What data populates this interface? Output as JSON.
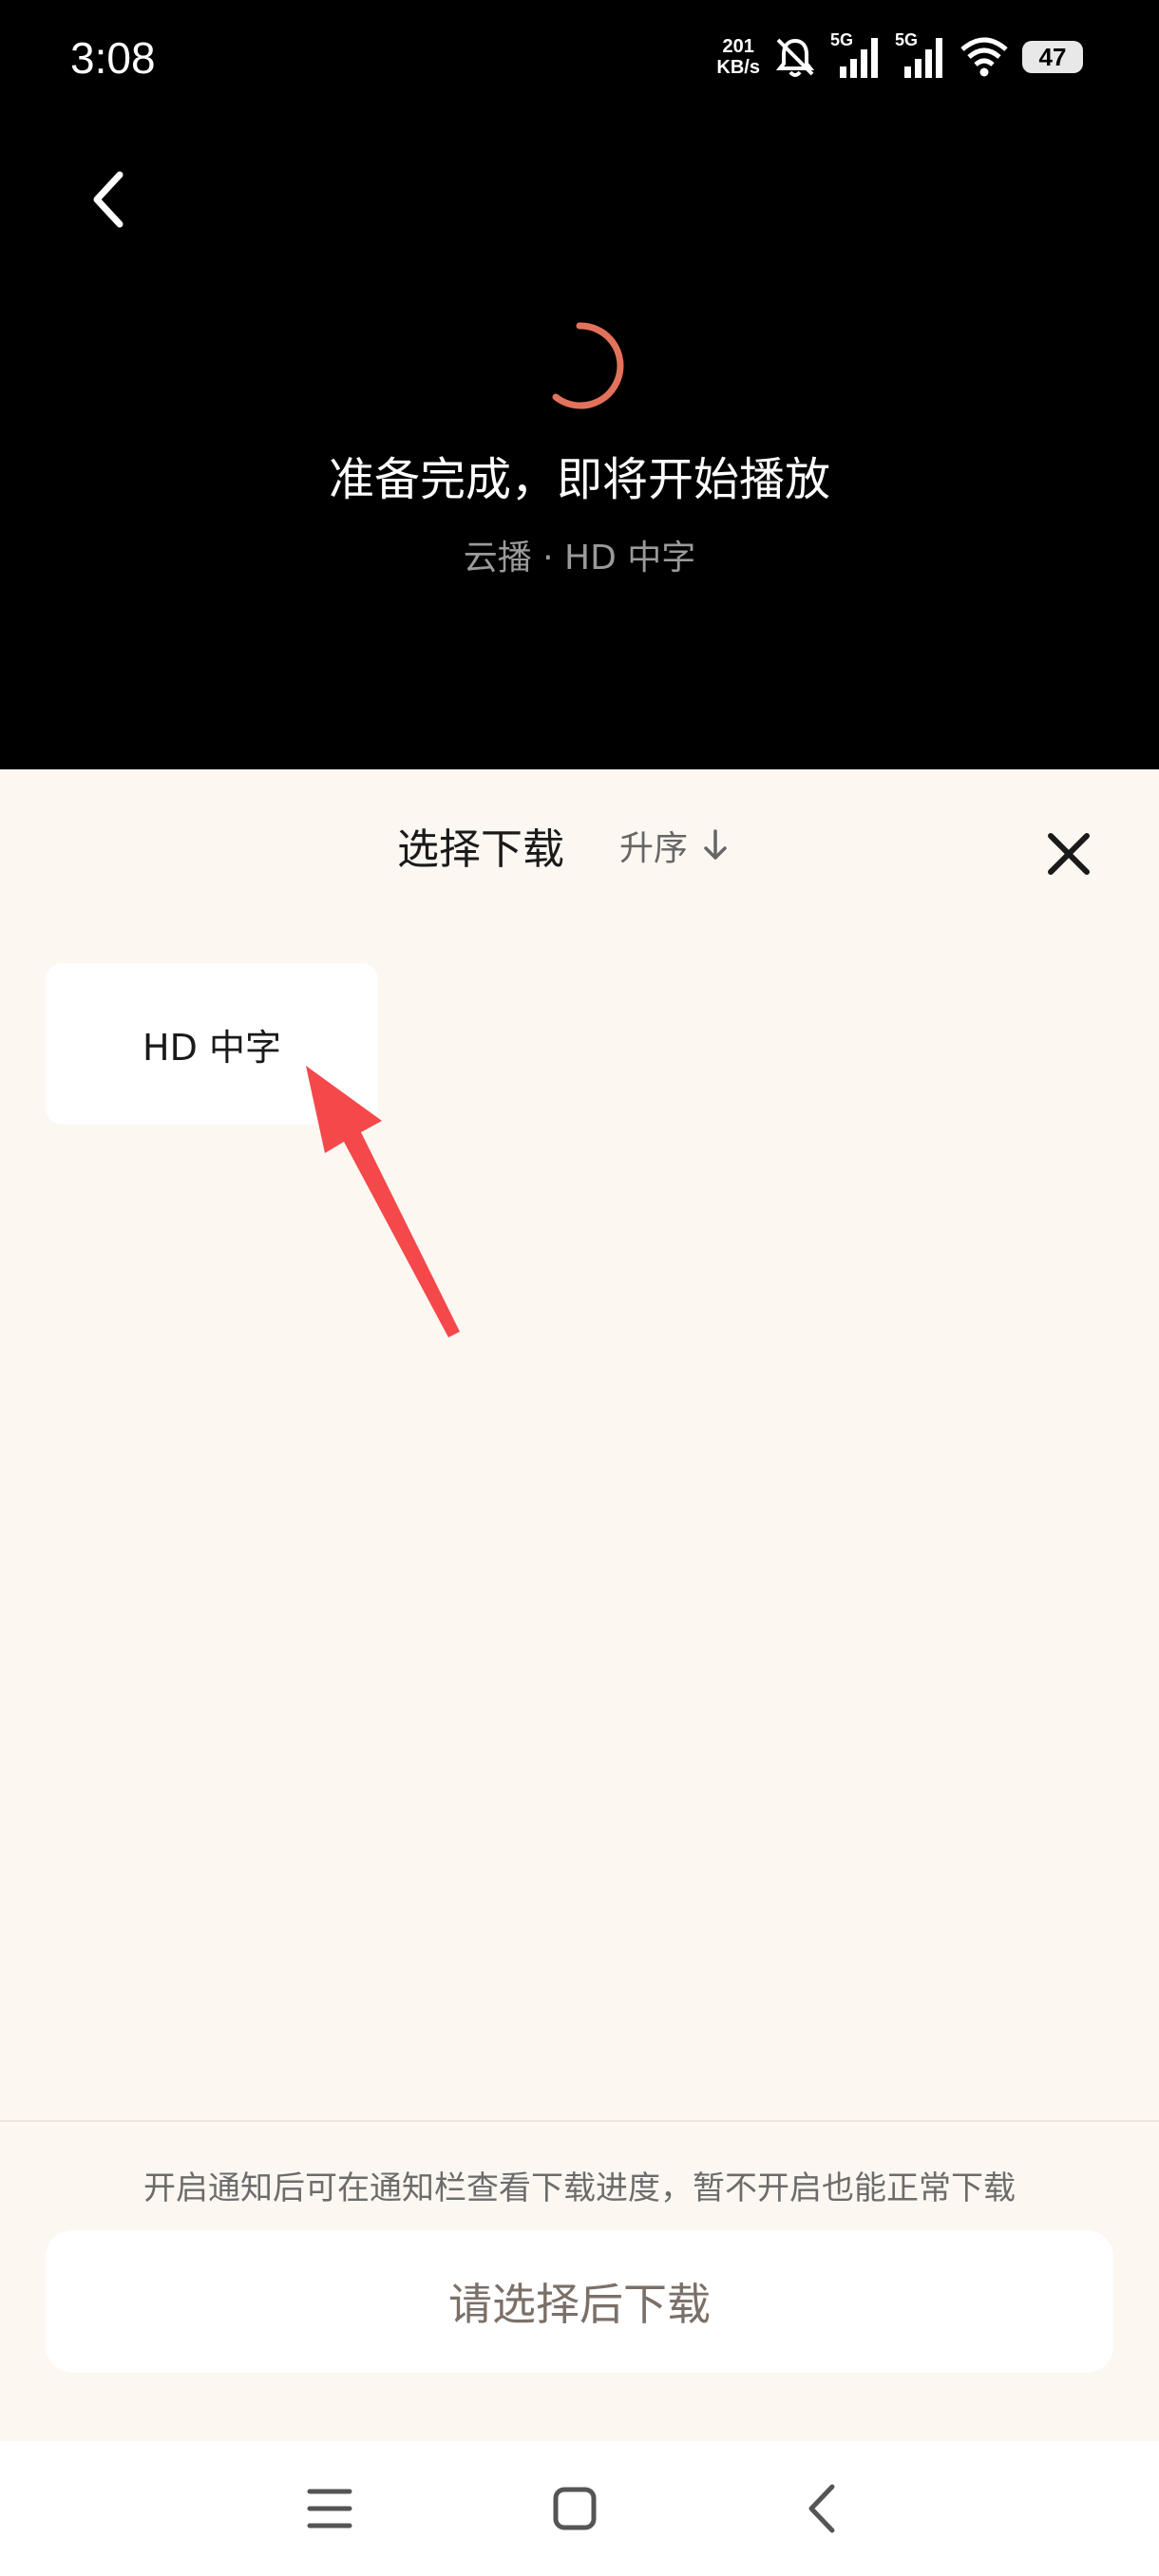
{
  "status_bar": {
    "time": "3:08",
    "net_speed_value": "201",
    "net_speed_unit": "KB/s",
    "sim1_label": "5G",
    "sim2_label": "5G",
    "battery": "47"
  },
  "player": {
    "status_title": "准备完成，即将开始播放",
    "status_subtitle": "云播 · HD 中字"
  },
  "sheet": {
    "title": "选择下载",
    "sort_label": "升序",
    "items": [
      {
        "label": "HD 中字"
      }
    ],
    "notice": "开启通知后可在通知栏查看下载进度，暂不开启也能正常下载",
    "download_button": "请选择后下载"
  },
  "colors": {
    "accent": "#e2725b",
    "sheet_bg": "#fdf7f2",
    "annotation_arrow": "#f4484a"
  }
}
